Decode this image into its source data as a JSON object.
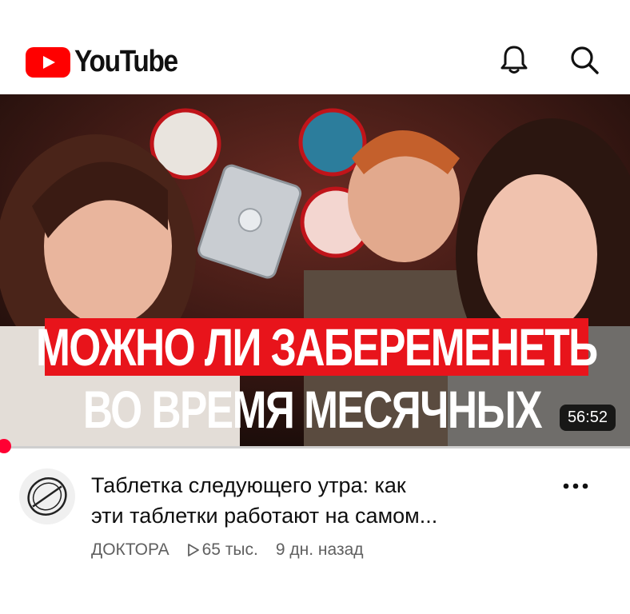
{
  "app": {
    "brand": "YouTube",
    "brand_color": "#ff0000"
  },
  "header": {
    "icons": [
      "bell-icon",
      "search-icon"
    ]
  },
  "video": {
    "thumbnail": {
      "headline_line1": "МОЖНО ЛИ ЗАБЕРЕМЕНЕТЬ",
      "headline_line2": "ВО ВРЕМЯ МЕСЯЧНЫХ",
      "headline_color": "#e8141b",
      "duration": "56:52"
    },
    "progress": 0.0,
    "title_line1": "Таблетка следующего утра: как",
    "title_line2": "эти таблетки работают на самом...",
    "channel": "ДОКТОРА",
    "views": "65 тыс.",
    "age": "9 дн. назад",
    "menu_icon": "more-vert-icon"
  }
}
